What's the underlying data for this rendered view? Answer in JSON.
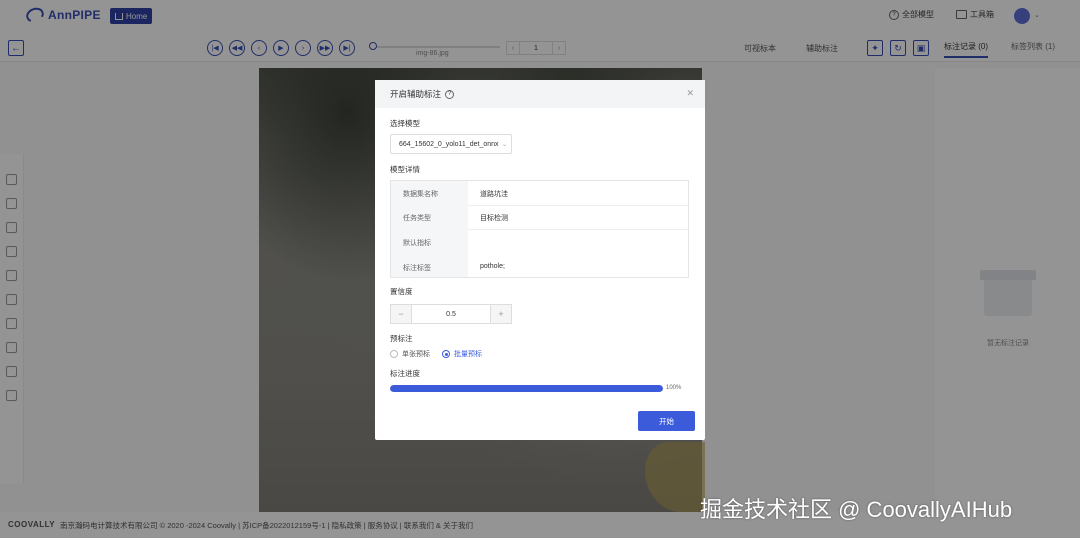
{
  "header": {
    "logo_text": "AnnPIPE",
    "home_label": "Home",
    "models_label": "全部模型",
    "toolbox_label": "工具箱"
  },
  "toolbar": {
    "image_name": "img-86.jpg",
    "page_value": "1",
    "pager_prev": "‹",
    "pager_next": "›",
    "visible_label": "可视标本",
    "assist_label": "辅助标注",
    "tab_records": "标注记录 (0)",
    "tab_labels": "标签列表 (1)"
  },
  "right_panel": {
    "empty_text": "暂无标注记录"
  },
  "modal": {
    "title": "开启辅助标注",
    "select_model_label": "选择模型",
    "selected_model": "664_15602_0_yolo11_det_onnx",
    "model_detail_label": "模型详情",
    "detail_rows": [
      {
        "key": "数据集名称",
        "value": "道路坑洼"
      },
      {
        "key": "任务类型",
        "value": "目标检测"
      },
      {
        "key": "默认指标",
        "value": ""
      },
      {
        "key": "标注标签",
        "value": "pothole;"
      }
    ],
    "confidence_label": "置信度",
    "confidence_value": "0.5",
    "stepper_minus": "−",
    "stepper_plus": "+",
    "prelabel_label": "预标注",
    "radio_single": "单张预标",
    "radio_batch": "批量预标",
    "progress_label": "标注进度",
    "progress_value": 1.0,
    "progress_text": "100%",
    "start_label": "开始"
  },
  "footer": {
    "brand": "COOVALLY",
    "text": "南京瀚码电计算技术有限公司 © 2020 -2024 Coovally | 苏ICP备2022012159号-1 | 隐私政策 | 服务协议 | 联系我们 & 关于我们"
  },
  "watermark": "掘金技术社区 @ CoovallyAIHub",
  "colors": {
    "accent": "#3b5bdb",
    "brand": "#2f43a8"
  }
}
